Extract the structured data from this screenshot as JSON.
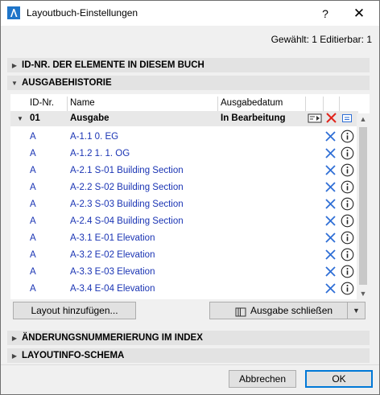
{
  "window": {
    "title": "Layoutbuch-Einstellungen",
    "help_label": "?",
    "close_label": "✕"
  },
  "selection_info": "Gewählt: 1 Editierbar: 1",
  "sections": {
    "element_ids": "ID-NR. DER ELEMENTE IN DIESEM BUCH",
    "issue_history": "AUSGABEHISTORIE",
    "revision_numbering": "ÄNDERUNGSNUMMERIERUNG IM INDEX",
    "layout_info_schema": "LAYOUTINFO-SCHEMA"
  },
  "table": {
    "columns": [
      "ID-Nr.",
      "Name",
      "Ausgabedatum"
    ],
    "group": {
      "id": "01",
      "name": "Ausgabe",
      "status": "In Bearbeitung"
    },
    "rows": [
      {
        "id": "A",
        "name": "A-1.1 0. EG"
      },
      {
        "id": "A",
        "name": "A-1.2 1. 1. OG"
      },
      {
        "id": "A",
        "name": "A-2.1 S-01 Building Section"
      },
      {
        "id": "A",
        "name": "A-2.2 S-02 Building Section"
      },
      {
        "id": "A",
        "name": "A-2.3 S-03 Building Section"
      },
      {
        "id": "A",
        "name": "A-2.4 S-04 Building Section"
      },
      {
        "id": "A",
        "name": "A-3.1 E-01 Elevation"
      },
      {
        "id": "A",
        "name": "A-3.2 E-02 Elevation"
      },
      {
        "id": "A",
        "name": "A-3.3 E-03 Elevation"
      },
      {
        "id": "A",
        "name": "A-3.4 E-04 Elevation"
      }
    ]
  },
  "buttons": {
    "add_layout": "Layout hinzufügen...",
    "close_issue": "Ausgabe schließen",
    "cancel": "Abbrechen",
    "ok": "OK"
  },
  "colors": {
    "link_blue": "#1a34b4",
    "remove_blue": "#2f6fd6",
    "delete_red": "#e1231b",
    "section_bg": "#e3e3e3"
  },
  "icons": {
    "app": "archicad-icon",
    "row_remove": "x-icon",
    "row_info": "info-icon",
    "issue_settings": "issue-settings-icon",
    "group_delete": "delete-icon",
    "group_list": "list-icon",
    "close_issue": "book-icon"
  }
}
